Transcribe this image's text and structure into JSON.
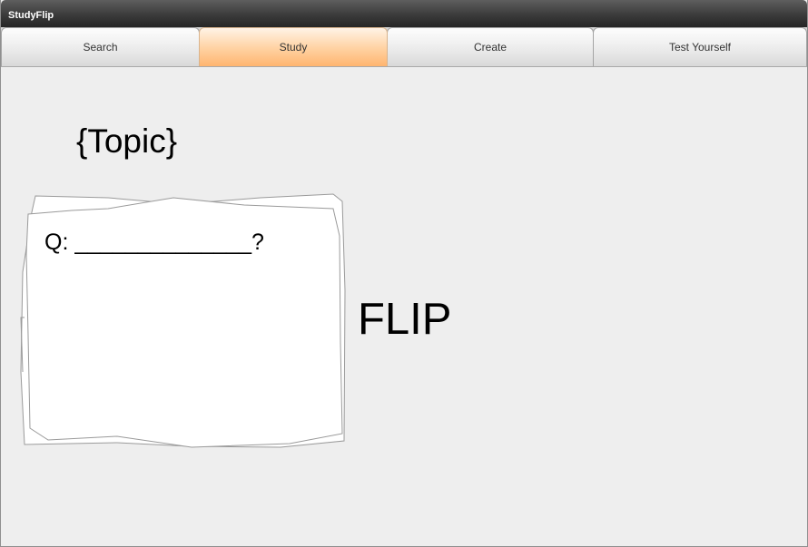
{
  "window": {
    "title": "StudyFlip"
  },
  "tabs": [
    {
      "label": "Search",
      "active": false
    },
    {
      "label": "Study",
      "active": true
    },
    {
      "label": "Create",
      "active": false
    },
    {
      "label": "Test Yourself",
      "active": false
    }
  ],
  "study": {
    "topic": "{Topic}",
    "question": "Q: ______________?",
    "flip_label": "FLIP"
  },
  "colors": {
    "titlebar": "#333333",
    "active_tab": "#ffc58a",
    "background": "#eeeeee",
    "card": "#ffffff"
  }
}
